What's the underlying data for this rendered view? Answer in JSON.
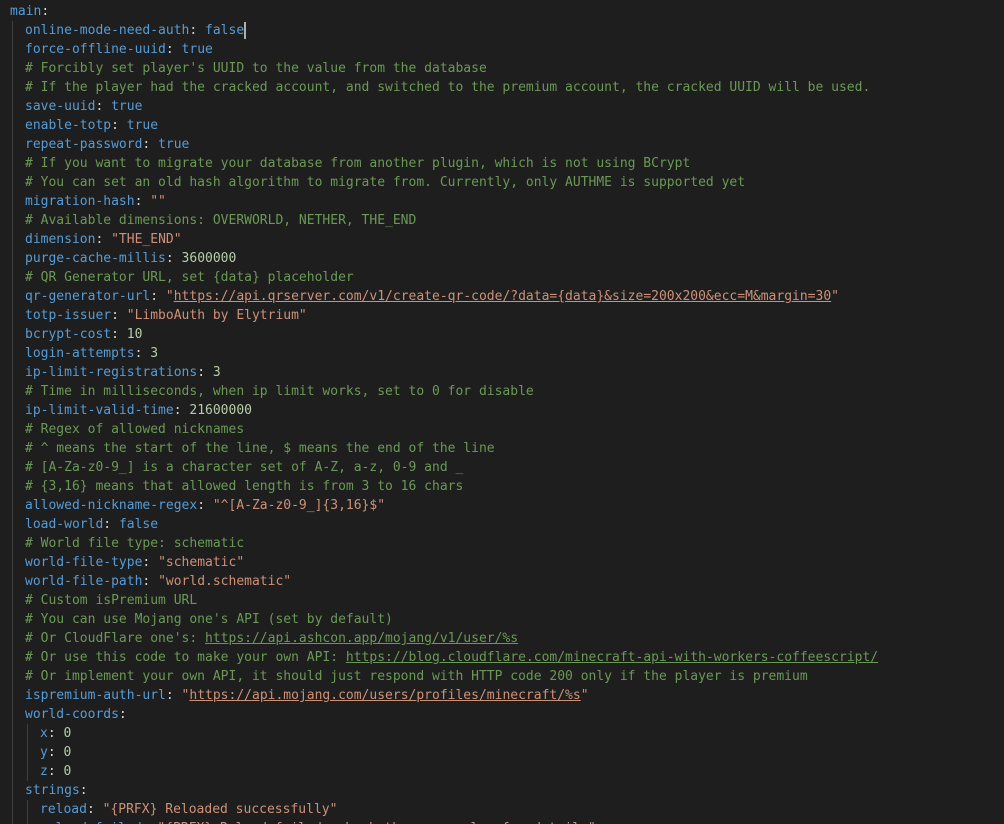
{
  "editor": {
    "lines": [
      {
        "indent": 0,
        "type": "key",
        "key": "main",
        "value": ""
      },
      {
        "indent": 1,
        "type": "key",
        "key": "online-mode-need-auth",
        "value": "false",
        "vtype": "bool",
        "cursor": true
      },
      {
        "indent": 1,
        "type": "key",
        "key": "force-offline-uuid",
        "value": "true",
        "vtype": "bool"
      },
      {
        "indent": 1,
        "type": "comment",
        "text": "# Forcibly set player's UUID to the value from the database"
      },
      {
        "indent": 1,
        "type": "comment",
        "text": "# If the player had the cracked account, and switched to the premium account, the cracked UUID will be used."
      },
      {
        "indent": 1,
        "type": "key",
        "key": "save-uuid",
        "value": "true",
        "vtype": "bool"
      },
      {
        "indent": 1,
        "type": "key",
        "key": "enable-totp",
        "value": "true",
        "vtype": "bool"
      },
      {
        "indent": 1,
        "type": "key",
        "key": "repeat-password",
        "value": "true",
        "vtype": "bool"
      },
      {
        "indent": 1,
        "type": "comment",
        "text": "# If you want to migrate your database from another plugin, which is not using BCrypt"
      },
      {
        "indent": 1,
        "type": "comment",
        "text": "# You can set an old hash algorithm to migrate from. Currently, only AUTHME is supported yet"
      },
      {
        "indent": 1,
        "type": "key",
        "key": "migration-hash",
        "value": "\"\"",
        "vtype": "str"
      },
      {
        "indent": 1,
        "type": "comment",
        "text": "# Available dimensions: OVERWORLD, NETHER, THE_END"
      },
      {
        "indent": 1,
        "type": "key",
        "key": "dimension",
        "value": "\"THE_END\"",
        "vtype": "str"
      },
      {
        "indent": 1,
        "type": "key",
        "key": "purge-cache-millis",
        "value": "3600000",
        "vtype": "num"
      },
      {
        "indent": 1,
        "type": "comment",
        "text": "# QR Generator URL, set {data} placeholder"
      },
      {
        "indent": 1,
        "type": "key",
        "key": "qr-generator-url",
        "value": "",
        "vtype": "url",
        "url": "https://api.qrserver.com/v1/create-qr-code/?data={data}&size=200x200&ecc=M&margin=30"
      },
      {
        "indent": 1,
        "type": "key",
        "key": "totp-issuer",
        "value": "\"LimboAuth by Elytrium\"",
        "vtype": "str"
      },
      {
        "indent": 1,
        "type": "key",
        "key": "bcrypt-cost",
        "value": "10",
        "vtype": "num"
      },
      {
        "indent": 1,
        "type": "key",
        "key": "login-attempts",
        "value": "3",
        "vtype": "num"
      },
      {
        "indent": 1,
        "type": "key",
        "key": "ip-limit-registrations",
        "value": "3",
        "vtype": "num"
      },
      {
        "indent": 1,
        "type": "comment",
        "text": "# Time in milliseconds, when ip limit works, set to 0 for disable"
      },
      {
        "indent": 1,
        "type": "key",
        "key": "ip-limit-valid-time",
        "value": "21600000",
        "vtype": "num"
      },
      {
        "indent": 1,
        "type": "comment",
        "text": "# Regex of allowed nicknames"
      },
      {
        "indent": 1,
        "type": "comment",
        "text": "# ^ means the start of the line, $ means the end of the line"
      },
      {
        "indent": 1,
        "type": "comment",
        "text": "# [A-Za-z0-9_] is a character set of A-Z, a-z, 0-9 and _"
      },
      {
        "indent": 1,
        "type": "comment",
        "text": "# {3,16} means that allowed length is from 3 to 16 chars"
      },
      {
        "indent": 1,
        "type": "key",
        "key": "allowed-nickname-regex",
        "value": "\"^[A-Za-z0-9_]{3,16}$\"",
        "vtype": "str"
      },
      {
        "indent": 1,
        "type": "key",
        "key": "load-world",
        "value": "false",
        "vtype": "bool"
      },
      {
        "indent": 1,
        "type": "comment",
        "text": "# World file type: schematic"
      },
      {
        "indent": 1,
        "type": "key",
        "key": "world-file-type",
        "value": "\"schematic\"",
        "vtype": "str"
      },
      {
        "indent": 1,
        "type": "key",
        "key": "world-file-path",
        "value": "\"world.schematic\"",
        "vtype": "str"
      },
      {
        "indent": 1,
        "type": "comment",
        "text": "# Custom isPremium URL"
      },
      {
        "indent": 1,
        "type": "comment",
        "text": "# You can use Mojang one's API (set by default)"
      },
      {
        "indent": 1,
        "type": "comment",
        "text": "# Or CloudFlare one's: ",
        "url": "https://api.ashcon.app/mojang/v1/user/%s"
      },
      {
        "indent": 1,
        "type": "comment",
        "text": "# Or use this code to make your own API: ",
        "url": "https://blog.cloudflare.com/minecraft-api-with-workers-coffeescript/"
      },
      {
        "indent": 1,
        "type": "comment",
        "text": "# Or implement your own API, it should just respond with HTTP code 200 only if the player is premium"
      },
      {
        "indent": 1,
        "type": "key",
        "key": "ispremium-auth-url",
        "value": "",
        "vtype": "url",
        "url": "https://api.mojang.com/users/profiles/minecraft/%s"
      },
      {
        "indent": 1,
        "type": "key",
        "key": "world-coords",
        "value": ""
      },
      {
        "indent": 2,
        "type": "key",
        "key": "x",
        "value": "0",
        "vtype": "num"
      },
      {
        "indent": 2,
        "type": "key",
        "key": "y",
        "value": "0",
        "vtype": "num"
      },
      {
        "indent": 2,
        "type": "key",
        "key": "z",
        "value": "0",
        "vtype": "num"
      },
      {
        "indent": 1,
        "type": "key",
        "key": "strings",
        "value": ""
      },
      {
        "indent": 2,
        "type": "key",
        "key": "reload",
        "value": "\"{PRFX} Reloaded successfully\"",
        "vtype": "str"
      },
      {
        "indent": 2,
        "type": "key",
        "key": "reload-failed",
        "value": "\"{PRFX} Reload failed: check the server log for details\"",
        "vtype": "str"
      }
    ]
  }
}
